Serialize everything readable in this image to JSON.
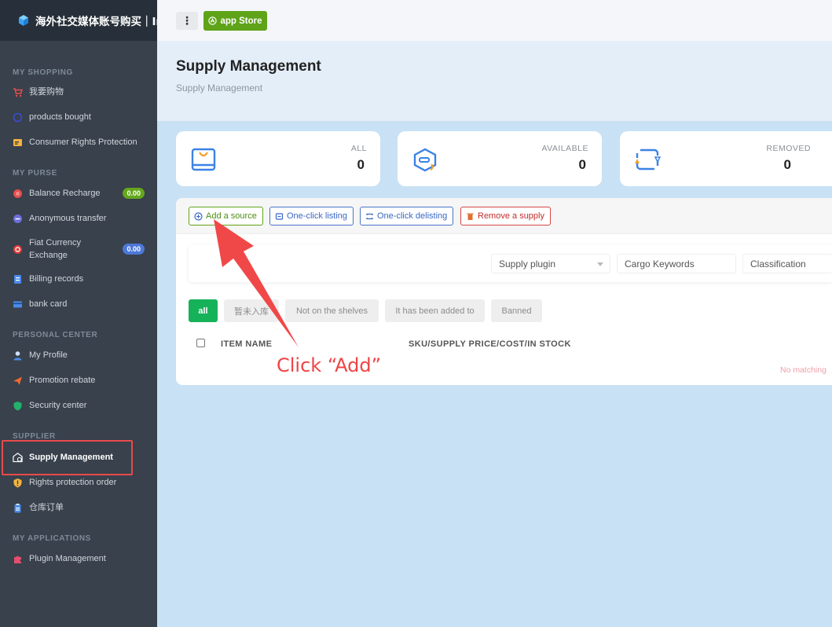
{
  "brand": {
    "name": "海外社交媒体账号购买｜Ins"
  },
  "topbar": {
    "menu_icon": "⋮",
    "app_store_label": "app Store"
  },
  "sidebar": {
    "sections": {
      "shopping": "MY SHOPPING",
      "purse": "MY PURSE",
      "personal": "PERSONAL CENTER",
      "supplier": "SUPPLIER",
      "applications": "MY APPLICATIONS"
    },
    "items": [
      {
        "label": "我要购物",
        "icon": "cart-icon",
        "color": "#e54d4d"
      },
      {
        "label": "products bought",
        "icon": "circle-icon",
        "color": "#3b4bd8"
      },
      {
        "label": "Consumer Rights Protection",
        "icon": "card-icon",
        "color": "#f2b441"
      },
      {
        "label": "Balance Recharge",
        "icon": "coin-icon",
        "color": "#e54d4d",
        "badge": "0.00"
      },
      {
        "label": "Anonymous transfer",
        "icon": "transfer-icon",
        "color": "#6b6fd8"
      },
      {
        "label": "Fiat Currency Exchange",
        "icon": "exchange-icon",
        "color": "#e03b3b",
        "badge": "0.00"
      },
      {
        "label": "Billing records",
        "icon": "bill-icon",
        "color": "#4a8be8"
      },
      {
        "label": "bank card",
        "icon": "bankcard-icon",
        "color": "#4a8be8"
      },
      {
        "label": "My Profile",
        "icon": "user-icon",
        "color": "#4a8be8"
      },
      {
        "label": "Promotion rebate",
        "icon": "paper-plane-icon",
        "color": "#ef6a32"
      },
      {
        "label": "Security center",
        "icon": "shield-icon",
        "color": "#21b36b"
      },
      {
        "label": "Supply Management",
        "icon": "warehouse-icon",
        "color": "#ffffff",
        "active": true
      },
      {
        "label": "Rights protection order",
        "icon": "warning-shield-icon",
        "color": "#f2b441"
      },
      {
        "label": "仓库订单",
        "icon": "clipboard-icon",
        "color": "#4a8be8"
      },
      {
        "label": "Plugin Management",
        "icon": "puzzle-icon",
        "color": "#e54d6e"
      }
    ]
  },
  "page": {
    "title": "Supply Management",
    "subtitle": "Supply Management"
  },
  "stats": [
    {
      "label": "ALL",
      "value": "0"
    },
    {
      "label": "AVAILABLE",
      "value": "0"
    },
    {
      "label": "REMOVED",
      "value": "0"
    }
  ],
  "toolbar": {
    "add_source": "Add a source",
    "one_click_listing": "One-click listing",
    "one_click_delisting": "One-click delisting",
    "remove_supply": "Remove a supply"
  },
  "filters": {
    "supply_plugin": "Supply plugin",
    "cargo_keywords": "Cargo Keywords",
    "classification": "Classification"
  },
  "tabs": [
    "all",
    "暂未入库",
    "Not on the shelves",
    "It has been added to",
    "Banned"
  ],
  "table": {
    "col_item_name": "ITEM NAME",
    "col_sku": "SKU/SUPPLY PRICE/COST/IN STOCK",
    "empty_text": "No matching"
  },
  "annotation": {
    "text": "Click “Add”",
    "color": "#ee4444"
  }
}
